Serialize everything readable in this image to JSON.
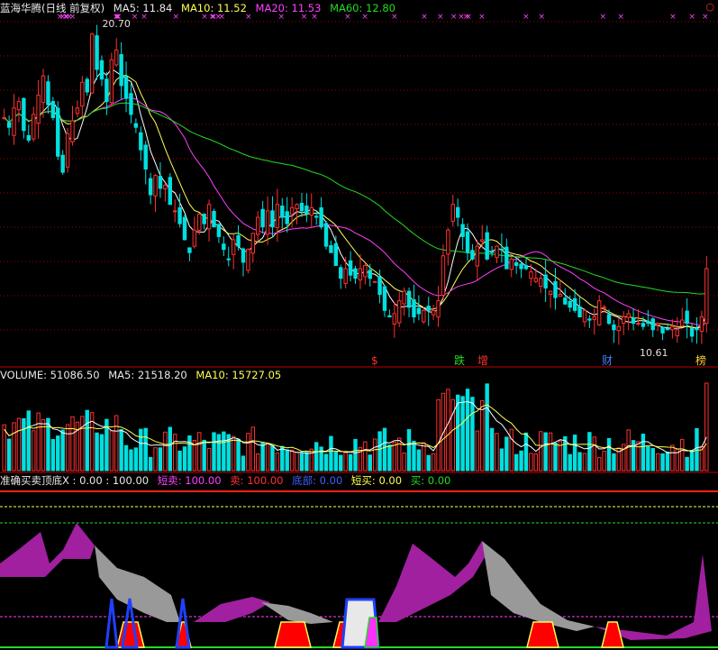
{
  "header": {
    "title": "蓝海华腾(日线 前复权)",
    "ma5": "MA5: 11.84",
    "ma10": "MA10: 11.52",
    "ma20": "MA20: 11.53",
    "ma60": "MA60: 12.80"
  },
  "volume_header": {
    "label": "VOLUME: 51086.50",
    "ma5": "MA5: 21518.20",
    "ma10": "MA10: 15727.05"
  },
  "indicator_header": {
    "title": "准确买卖顶底X : 0.00 : 100.00",
    "short_sell": "短卖: 100.00",
    "sell": "卖: 100.00",
    "bottom": "底部: 0.00",
    "short_buy": "短买: 0.00",
    "buy": "买: 0.00"
  },
  "annotations": {
    "high_label": "20.70",
    "low_label": "10.61",
    "markers": [
      "$",
      "跌",
      "增",
      "财",
      "榜"
    ]
  },
  "colors": {
    "up": "#ff3030",
    "down": "#00e0e0",
    "ma5": "#ffffff",
    "ma10": "#ffff55",
    "ma20": "#ff40ff",
    "ma60": "#22dd22",
    "grid": "#a00000"
  },
  "chart_data": {
    "type": "candlestick",
    "price_range": [
      10.6,
      20.7
    ],
    "closes": [
      17.6,
      17.3,
      17.9,
      18.1,
      17.2,
      16.9,
      17.7,
      18.3,
      18.9,
      18.0,
      17.6,
      16.4,
      15.9,
      17.1,
      17.5,
      17.9,
      18.7,
      18.4,
      20.2,
      19.1,
      18.8,
      18.1,
      19.4,
      19.7,
      18.6,
      18.2,
      17.7,
      17.3,
      16.6,
      16.0,
      15.2,
      15.8,
      15.4,
      15.5,
      14.9,
      14.7,
      14.3,
      13.8,
      13.4,
      14.1,
      14.6,
      14.3,
      14.9,
      14.2,
      13.9,
      13.5,
      13.2,
      13.8,
      13.6,
      13.1,
      13.5,
      14.0,
      14.5,
      14.2,
      14.7,
      14.2,
      14.9,
      14.5,
      14.3,
      14.8,
      14.9,
      14.7,
      14.6,
      14.8,
      14.5,
      14.2,
      13.6,
      13.4,
      13.0,
      12.6,
      12.9,
      12.7,
      12.6,
      12.9,
      13.0,
      12.6,
      12.5,
      12.1,
      11.6,
      11.4,
      11.5,
      11.9,
      12.2,
      11.7,
      11.4,
      11.5,
      11.6,
      11.6,
      11.6,
      11.9,
      13.3,
      14.1,
      14.9,
      14.5,
      13.9,
      13.4,
      13.2,
      13.6,
      13.8,
      13.2,
      13.4,
      13.6,
      13.5,
      12.9,
      13.2,
      13.0,
      12.9,
      12.9,
      12.8,
      12.6,
      12.6,
      12.3,
      12.2,
      12.0,
      12.1,
      11.8,
      11.7,
      11.6,
      11.4,
      11.6,
      11.3,
      11.4,
      11.9,
      11.7,
      11.2,
      11.0,
      11.1,
      11.4,
      11.5,
      11.2,
      11.2,
      11.1,
      11.2,
      11.0,
      11.2,
      10.9,
      11.0,
      11.1,
      11.0,
      11.3,
      11.2,
      10.8,
      11.0,
      11.4,
      12.9
    ],
    "volume_max": 51086.5,
    "volume_ma5": 21518.2,
    "volume_ma10": 15727.05,
    "indicator": {
      "x": 0.0,
      "range": [
        0,
        100
      ],
      "short_sell": 100.0,
      "sell": 100.0,
      "bottom": 0.0,
      "short_buy": 0.0,
      "buy": 0.0
    }
  }
}
